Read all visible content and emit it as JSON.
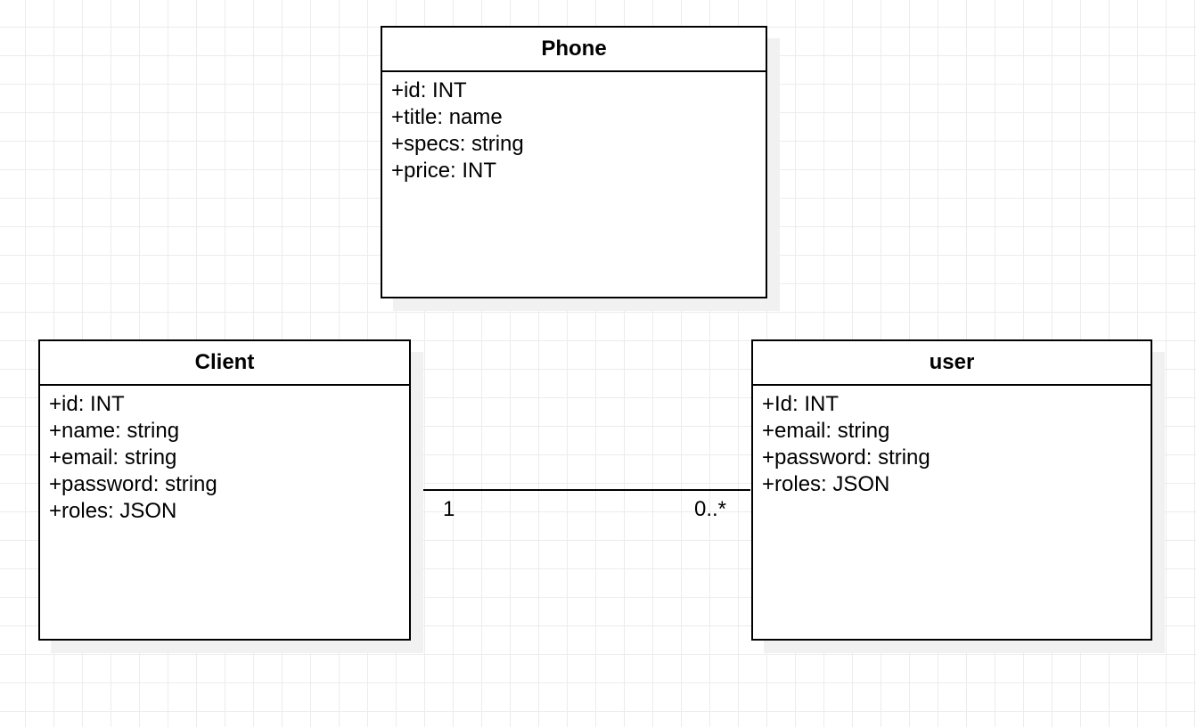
{
  "diagram": {
    "type": "uml-class-diagram",
    "classes": {
      "phone": {
        "name": "Phone",
        "attributes": [
          "+id: INT",
          "+title: name",
          "+specs: string",
          "+price: INT"
        ]
      },
      "client": {
        "name": "Client",
        "attributes": [
          "+id: INT",
          "+name: string",
          "+email: string",
          "+password: string",
          "+roles: JSON"
        ]
      },
      "user": {
        "name": "user",
        "attributes": [
          "+Id: INT",
          "+email: string",
          "+password: string",
          "+roles: JSON"
        ]
      }
    },
    "associations": [
      {
        "from": "Client",
        "to": "user",
        "from_multiplicity": "1",
        "to_multiplicity": "0..*"
      }
    ]
  }
}
